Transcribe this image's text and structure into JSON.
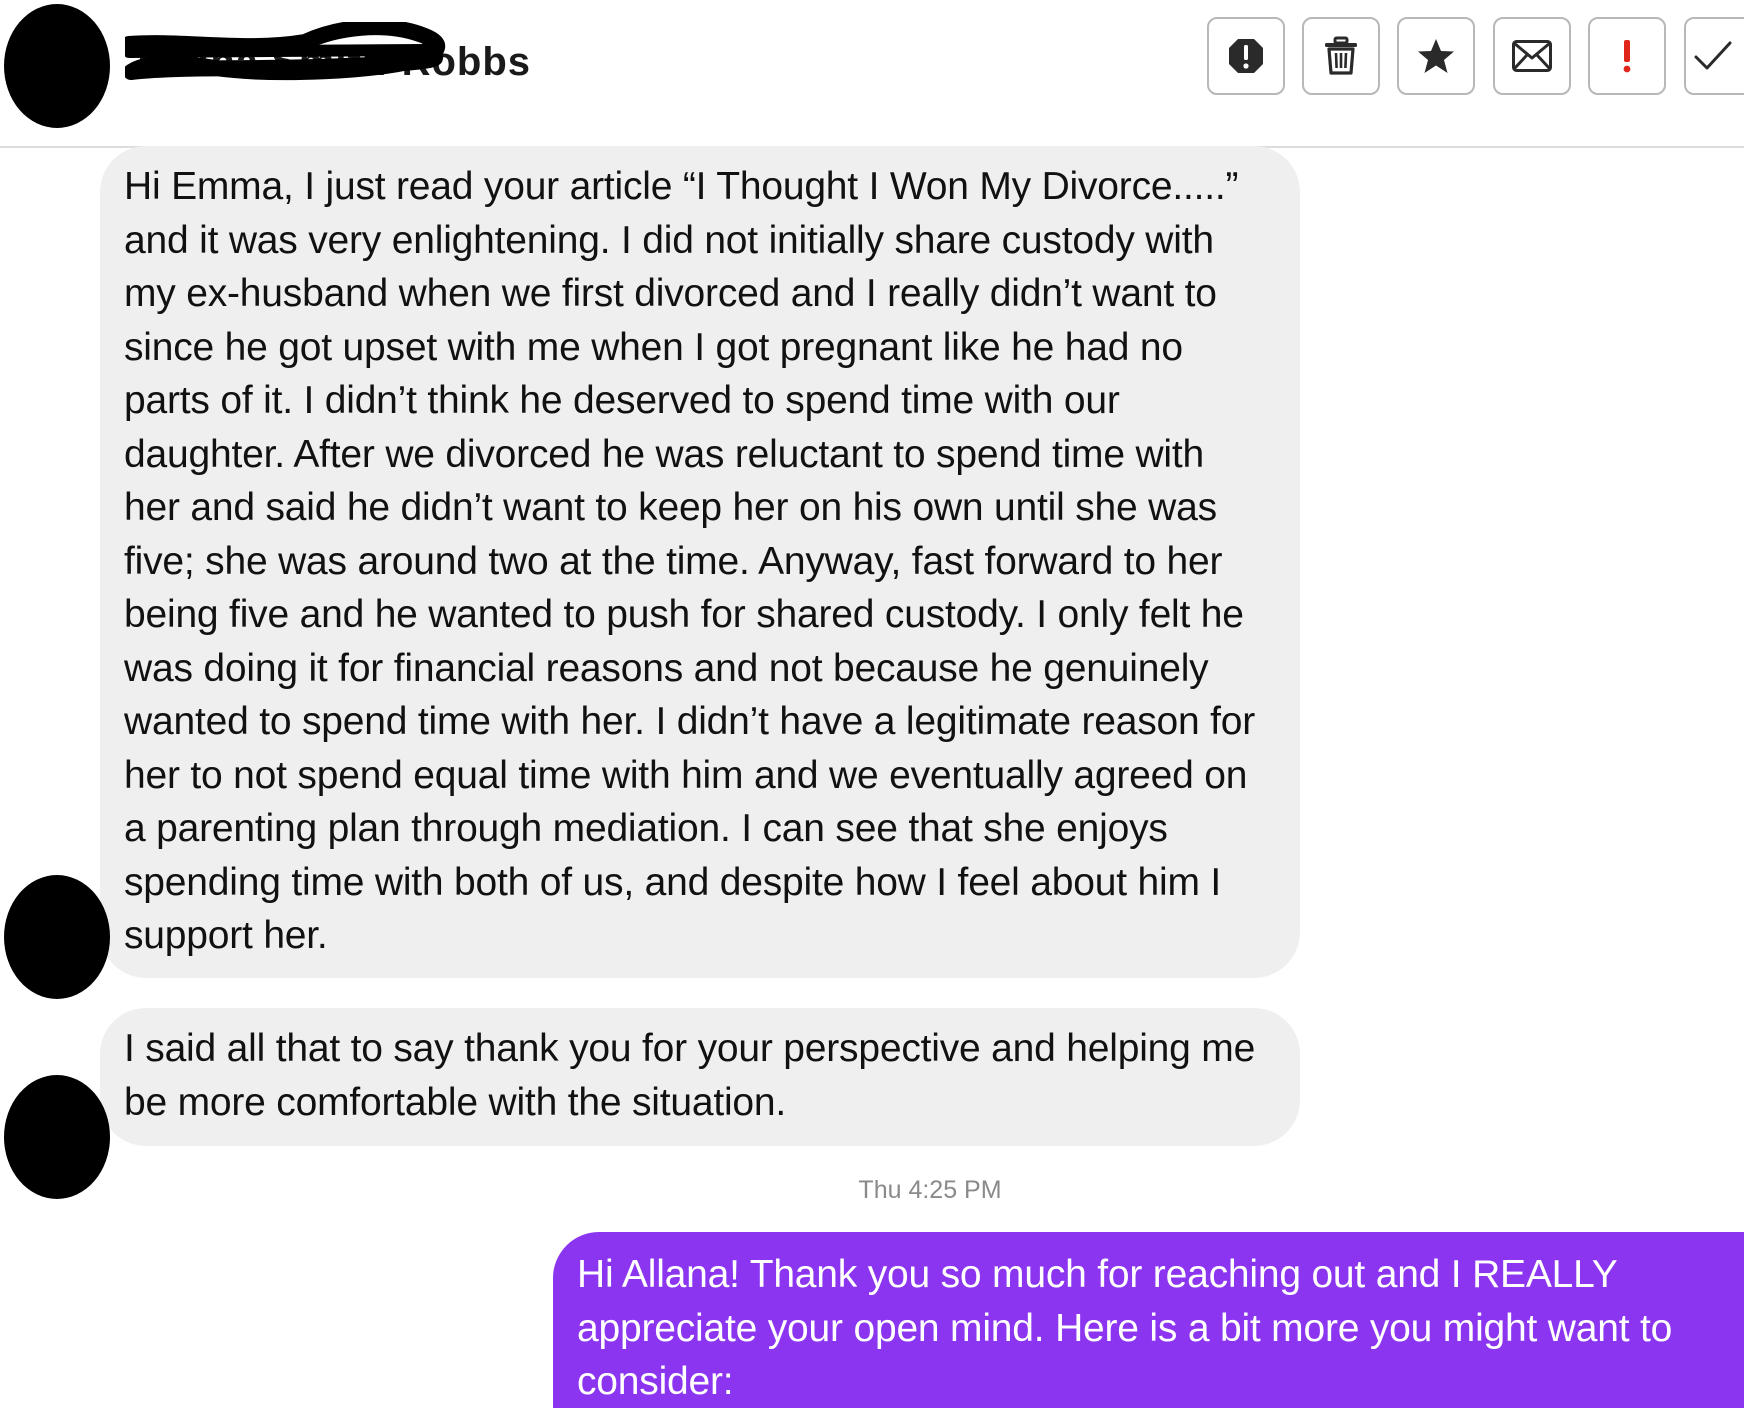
{
  "header": {
    "contact_name": "Allana Smith-Robbs",
    "actions": [
      {
        "name": "report-button",
        "icon": "alert-octagon-icon"
      },
      {
        "name": "delete-button",
        "icon": "trash-icon"
      },
      {
        "name": "star-button",
        "icon": "star-icon"
      },
      {
        "name": "mark-unread-button",
        "icon": "envelope-icon"
      },
      {
        "name": "flag-urgent-button",
        "icon": "exclamation-icon"
      },
      {
        "name": "mark-done-button",
        "icon": "checkmark-icon"
      }
    ]
  },
  "messages": [
    {
      "direction": "incoming",
      "lines": [
        "Hi Emma, I just read your article “I Thought I Won My Divorce.....”",
        "and it was very enlightening. I did not initially share custody with",
        "my ex-husband when we first divorced and I really didn’t want to",
        "since he got upset with me when I got pregnant like he had no",
        "parts of it. I didn’t think he deserved to spend time with our",
        "daughter. After we divorced he was reluctant to spend time with",
        "her and said he didn’t want to keep her on his own until she was",
        "five; she was around two at the time. Anyway, fast forward to her",
        "being five and he wanted to push for shared custody. I only felt he",
        "was doing it for financial reasons and not because he genuinely",
        "wanted to spend time with her. I didn’t have a legitimate reason for",
        "her to not spend equal time with him and we eventually agreed on",
        "a parenting plan through mediation. I can see that she enjoys",
        "spending time with both of us, and despite how I feel about him I",
        "support her."
      ]
    },
    {
      "direction": "incoming",
      "lines": [
        "I said all that to say thank you for your perspective and helping me",
        "be more comfortable with the situation."
      ]
    },
    {
      "direction": "outgoing",
      "lines": [
        "Hi Allana! Thank you so much for reaching out and I REALLY",
        "appreciate your open mind. Here is a bit more you might want to",
        "consider:"
      ]
    }
  ],
  "timestamp": "Thu 4:25 PM",
  "colors": {
    "incoming_bubble": "#efefef",
    "outgoing_bubble": "#8b35f0",
    "flag_red": "#e0261b"
  }
}
